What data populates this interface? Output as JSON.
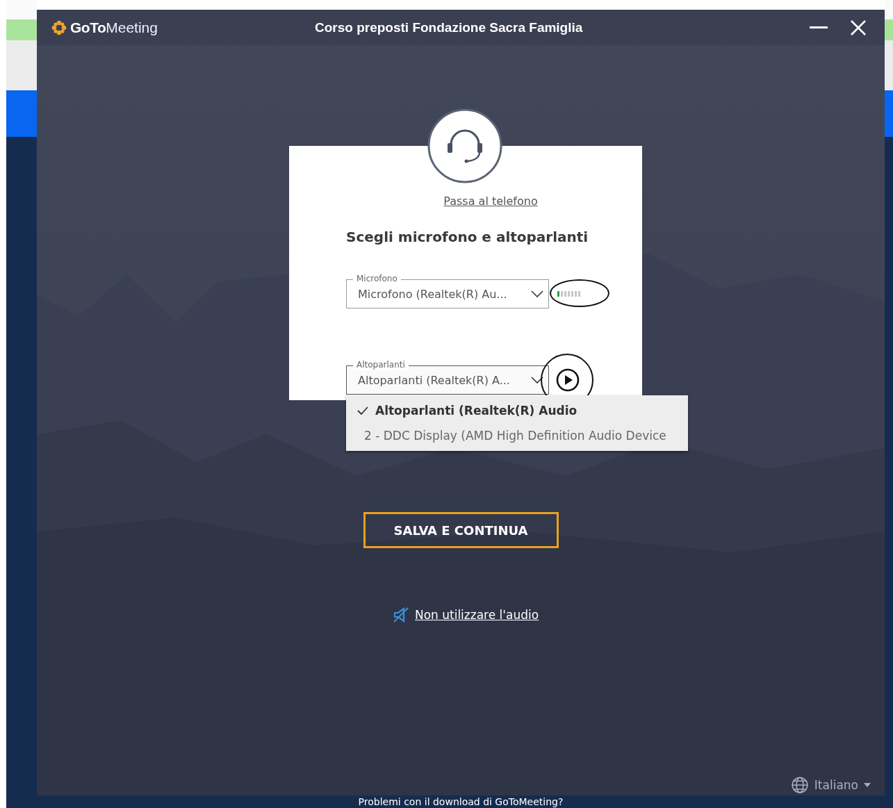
{
  "window": {
    "logo": {
      "bold": "GoTo",
      "light": "Meeting"
    },
    "title": "Corso preposti Fondazione Sacra Famiglia"
  },
  "card": {
    "phone_link": "Passa al telefono",
    "heading": "Scegli microfono e altoparlanti",
    "fields": [
      {
        "kind": "microphone",
        "label": "Microfono",
        "value": "Microfono (Realtek(R) Au...",
        "expanded": false,
        "meter": {
          "level": 0.14
        }
      },
      {
        "kind": "speaker",
        "label": "Altoparlanti",
        "value": "Altoparlanti (Realtek(R) A...",
        "expanded": true
      }
    ],
    "dropdown": [
      {
        "label": "Altoparlanti (Realtek(R) Audio",
        "selected": true
      },
      {
        "label": "2 - DDC Display (AMD High Definition Audio Device",
        "selected": false
      }
    ]
  },
  "save_button": "SALVA E CONTINUA",
  "no_audio_link": "Non utilizzare l'audio",
  "language": "Italiano",
  "footer": "Problemi con il download di GoToMeeting?"
}
